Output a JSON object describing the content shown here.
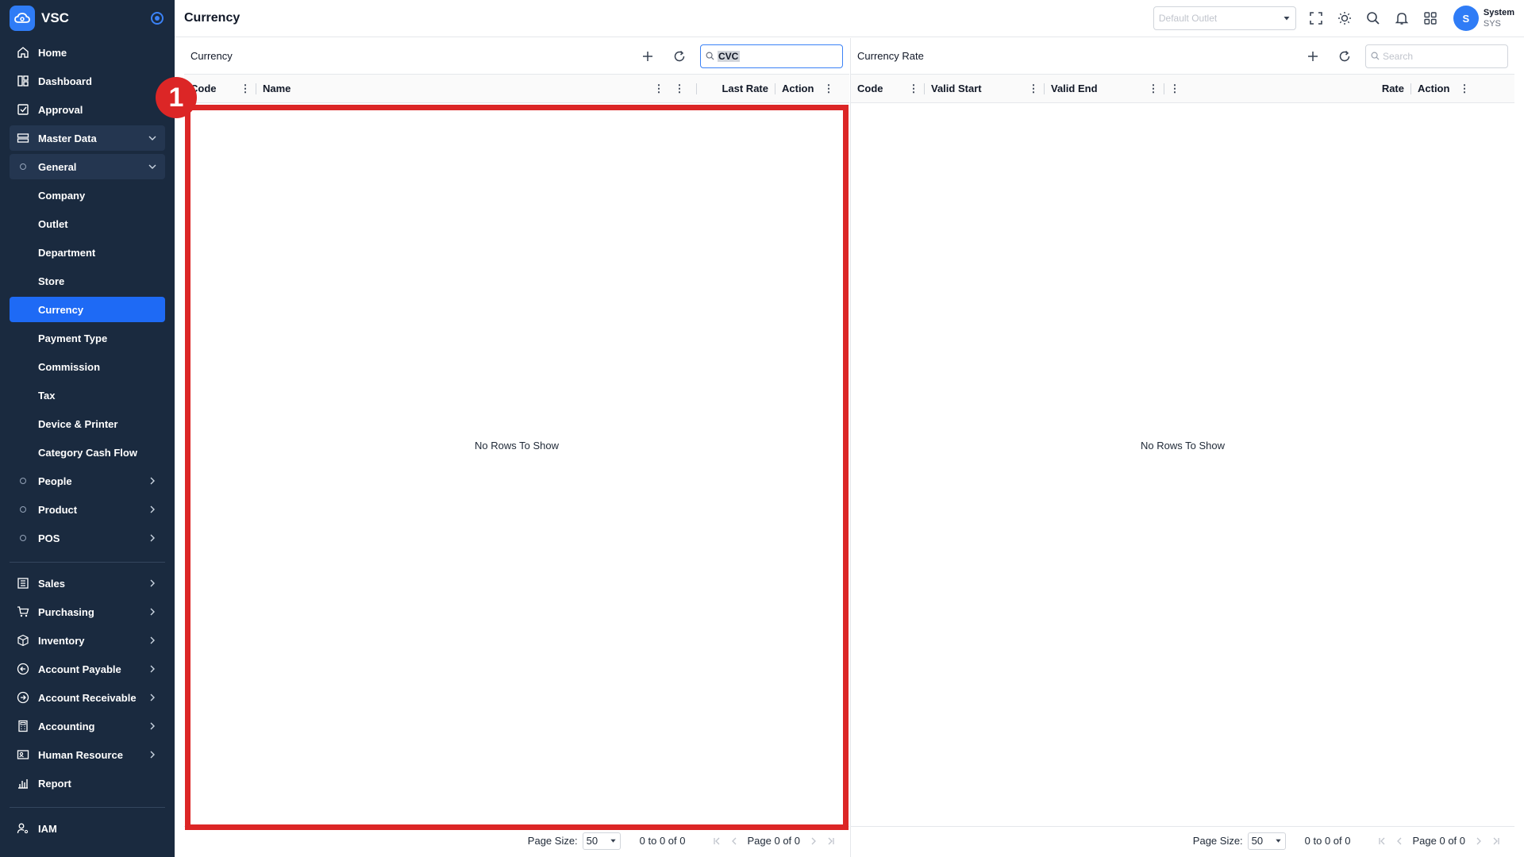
{
  "app": {
    "name": "VSC"
  },
  "sidebar": {
    "items": [
      {
        "label": "Home",
        "icon": "home-icon"
      },
      {
        "label": "Dashboard",
        "icon": "dashboard-icon"
      },
      {
        "label": "Approval",
        "icon": "approval-icon"
      },
      {
        "label": "Master Data",
        "icon": "master-data-icon"
      },
      {
        "label": "General"
      },
      {
        "label": "Company"
      },
      {
        "label": "Outlet"
      },
      {
        "label": "Department"
      },
      {
        "label": "Store"
      },
      {
        "label": "Currency"
      },
      {
        "label": "Payment Type"
      },
      {
        "label": "Commission"
      },
      {
        "label": "Tax"
      },
      {
        "label": "Device & Printer"
      },
      {
        "label": "Category Cash Flow"
      },
      {
        "label": "People"
      },
      {
        "label": "Product"
      },
      {
        "label": "POS"
      },
      {
        "label": "Sales",
        "icon": "sales-icon"
      },
      {
        "label": "Purchasing",
        "icon": "cart-icon"
      },
      {
        "label": "Inventory",
        "icon": "box-icon"
      },
      {
        "label": "Account Payable",
        "icon": "arrow-left-circle-icon"
      },
      {
        "label": "Account Receivable",
        "icon": "arrow-right-circle-icon"
      },
      {
        "label": "Accounting",
        "icon": "calculator-icon"
      },
      {
        "label": "Human Resource",
        "icon": "id-card-icon"
      },
      {
        "label": "Report",
        "icon": "bar-chart-icon"
      },
      {
        "label": "IAM",
        "icon": "user-key-icon"
      }
    ]
  },
  "header": {
    "title": "Currency",
    "outlet_placeholder": "Default Outlet",
    "user": {
      "initial": "S",
      "name": "System",
      "code": "SYS"
    }
  },
  "currency_panel": {
    "title": "Currency",
    "search_value": "CVC",
    "columns": [
      "Code",
      "Name",
      "Last Rate",
      "Action"
    ],
    "empty_text": "No Rows To Show",
    "page_size_label": "Page Size:",
    "page_size": "50",
    "summary": "0 to 0 of 0",
    "page_text": "Page 0 of 0"
  },
  "rate_panel": {
    "title": "Currency Rate",
    "search_placeholder": "Search",
    "columns": [
      "Code",
      "Valid Start",
      "Valid End",
      "Rate",
      "Action"
    ],
    "empty_text": "No Rows To Show",
    "page_size_label": "Page Size:",
    "page_size": "50",
    "summary": "0 to 0 of 0",
    "page_text": "Page 0 of 0"
  },
  "annotation": {
    "number": "1",
    "color": "#dc2626"
  },
  "colors": {
    "sidebar_bg": "#1a2a3f",
    "accent": "#1e6af5"
  }
}
